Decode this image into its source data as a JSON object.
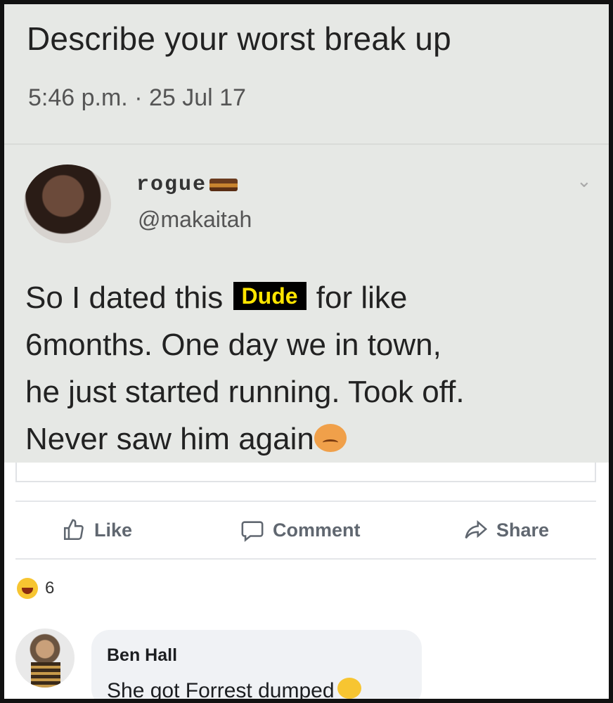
{
  "tweet": {
    "title": "Describe your worst break up",
    "timestamp": "5:46 p.m. · 25 Jul 17",
    "reply": {
      "display_name": "rogue",
      "handle": "@makaitah",
      "body_part1": "So I dated this",
      "redacted_word": "Dude",
      "body_part2": "for like",
      "body_line2": "6months. One day we in town,",
      "body_line3": "he just started running. Took off.",
      "body_line4": "Never saw him again"
    }
  },
  "actions": {
    "like_label": "Like",
    "comment_label": "Comment",
    "share_label": "Share"
  },
  "reactions": {
    "count": "6",
    "icon": "haha-icon"
  },
  "comment": {
    "author": "Ben Hall",
    "text": "She got Forrest dumped"
  },
  "colors": {
    "tweet_background": "#e6e8e5",
    "redact_background": "#000000",
    "redact_text": "#ffe500",
    "action_text": "#606770"
  }
}
